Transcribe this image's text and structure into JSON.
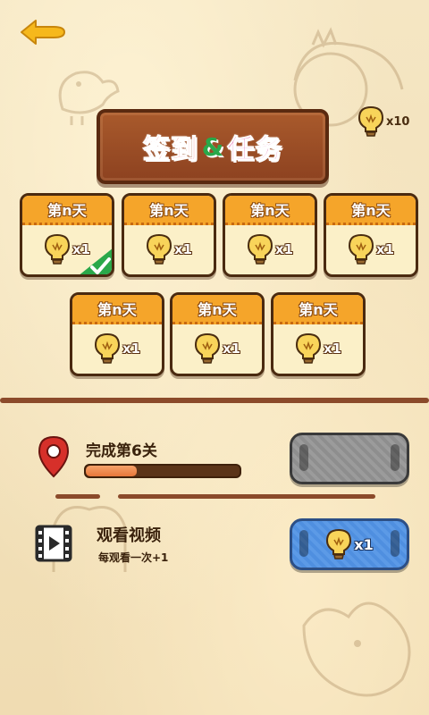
{
  "header": {
    "back_icon": "back-arrow-icon",
    "bulb_total": "x10"
  },
  "title": {
    "part1": "签到",
    "amp": "&",
    "part2": "任务"
  },
  "checkin": {
    "days": [
      {
        "label": "第n天",
        "reward": "x1",
        "claimed": true
      },
      {
        "label": "第n天",
        "reward": "x1",
        "claimed": false
      },
      {
        "label": "第n天",
        "reward": "x1",
        "claimed": false
      },
      {
        "label": "第n天",
        "reward": "x1",
        "claimed": false
      },
      {
        "label": "第n天",
        "reward": "x1",
        "claimed": false
      },
      {
        "label": "第n天",
        "reward": "x1",
        "claimed": false
      },
      {
        "label": "第n天",
        "reward": "x1",
        "claimed": false
      }
    ]
  },
  "tasks": {
    "level": {
      "title": "完成第6关",
      "progress": 0.33,
      "icon": "map-pin-icon"
    },
    "video": {
      "title": "观看视频",
      "subtitle": "每观看一次+1",
      "reward": "x1",
      "icon": "film-play-icon"
    }
  },
  "colors": {
    "accent_orange": "#f5a52a",
    "plate_brown": "#9a4b25",
    "title_red": "#e8262a",
    "title_green": "#2aa84a",
    "title_pink": "#d52d8f",
    "claim_blue": "#4f8fe0",
    "locked_gray": "#8e8e8e"
  }
}
